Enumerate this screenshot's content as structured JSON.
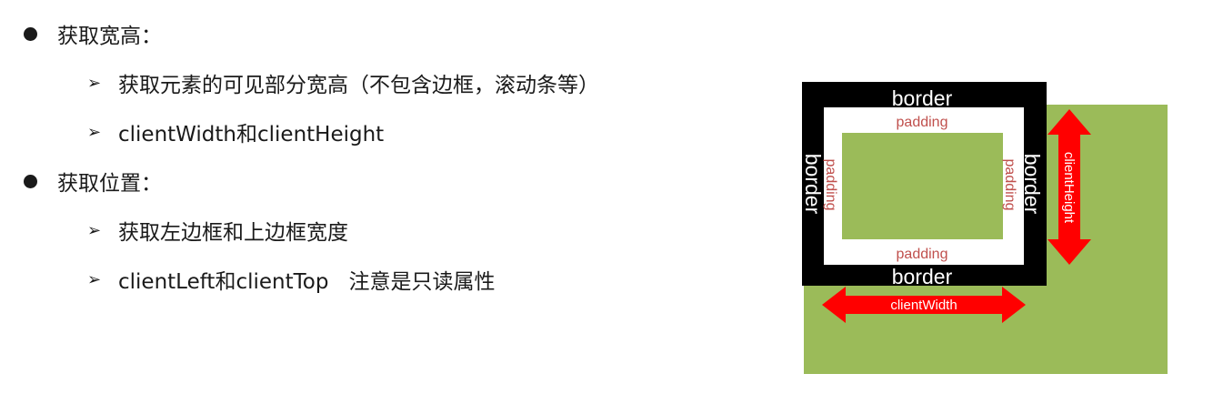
{
  "list": {
    "section1": {
      "title": "获取宽高：",
      "sub1": "获取元素的可见部分宽高（不包含边框，滚动条等）",
      "sub2": "clientWidth和clientHeight"
    },
    "section2": {
      "title": "获取位置：",
      "sub1": "获取左边框和上边框宽度",
      "sub2_a": "clientLeft和clientTop",
      "sub2_b": "注意是只读属性"
    }
  },
  "diagram": {
    "border_top": "border",
    "border_bottom": "border",
    "border_left": "border",
    "border_right": "border",
    "padding_top": "padding",
    "padding_bottom": "padding",
    "padding_left": "padding",
    "padding_right": "padding",
    "client_width": "clientWidth",
    "client_height": "clientHeight"
  },
  "colors": {
    "green": "#9bbb59",
    "border_black": "#000000",
    "padding_text": "#c0504d",
    "arrow_red": "#ff0000"
  }
}
